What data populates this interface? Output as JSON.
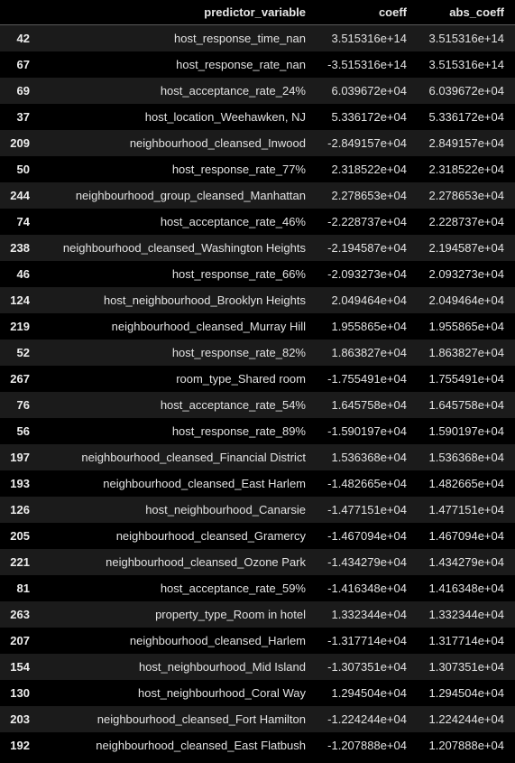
{
  "table": {
    "headers": [
      "",
      "predictor_variable",
      "coeff",
      "abs_coeff"
    ],
    "rows": [
      {
        "index": "42",
        "predictor": "host_response_time_nan",
        "coeff": "3.515316e+14",
        "abs_coeff": "3.515316e+14"
      },
      {
        "index": "67",
        "predictor": "host_response_rate_nan",
        "coeff": "-3.515316e+14",
        "abs_coeff": "3.515316e+14"
      },
      {
        "index": "69",
        "predictor": "host_acceptance_rate_24%",
        "coeff": "6.039672e+04",
        "abs_coeff": "6.039672e+04"
      },
      {
        "index": "37",
        "predictor": "host_location_Weehawken, NJ",
        "coeff": "5.336172e+04",
        "abs_coeff": "5.336172e+04"
      },
      {
        "index": "209",
        "predictor": "neighbourhood_cleansed_Inwood",
        "coeff": "-2.849157e+04",
        "abs_coeff": "2.849157e+04"
      },
      {
        "index": "50",
        "predictor": "host_response_rate_77%",
        "coeff": "2.318522e+04",
        "abs_coeff": "2.318522e+04"
      },
      {
        "index": "244",
        "predictor": "neighbourhood_group_cleansed_Manhattan",
        "coeff": "2.278653e+04",
        "abs_coeff": "2.278653e+04"
      },
      {
        "index": "74",
        "predictor": "host_acceptance_rate_46%",
        "coeff": "-2.228737e+04",
        "abs_coeff": "2.228737e+04"
      },
      {
        "index": "238",
        "predictor": "neighbourhood_cleansed_Washington Heights",
        "coeff": "-2.194587e+04",
        "abs_coeff": "2.194587e+04"
      },
      {
        "index": "46",
        "predictor": "host_response_rate_66%",
        "coeff": "-2.093273e+04",
        "abs_coeff": "2.093273e+04"
      },
      {
        "index": "124",
        "predictor": "host_neighbourhood_Brooklyn Heights",
        "coeff": "2.049464e+04",
        "abs_coeff": "2.049464e+04"
      },
      {
        "index": "219",
        "predictor": "neighbourhood_cleansed_Murray Hill",
        "coeff": "1.955865e+04",
        "abs_coeff": "1.955865e+04"
      },
      {
        "index": "52",
        "predictor": "host_response_rate_82%",
        "coeff": "1.863827e+04",
        "abs_coeff": "1.863827e+04"
      },
      {
        "index": "267",
        "predictor": "room_type_Shared room",
        "coeff": "-1.755491e+04",
        "abs_coeff": "1.755491e+04"
      },
      {
        "index": "76",
        "predictor": "host_acceptance_rate_54%",
        "coeff": "1.645758e+04",
        "abs_coeff": "1.645758e+04"
      },
      {
        "index": "56",
        "predictor": "host_response_rate_89%",
        "coeff": "-1.590197e+04",
        "abs_coeff": "1.590197e+04"
      },
      {
        "index": "197",
        "predictor": "neighbourhood_cleansed_Financial District",
        "coeff": "1.536368e+04",
        "abs_coeff": "1.536368e+04"
      },
      {
        "index": "193",
        "predictor": "neighbourhood_cleansed_East Harlem",
        "coeff": "-1.482665e+04",
        "abs_coeff": "1.482665e+04"
      },
      {
        "index": "126",
        "predictor": "host_neighbourhood_Canarsie",
        "coeff": "-1.477151e+04",
        "abs_coeff": "1.477151e+04"
      },
      {
        "index": "205",
        "predictor": "neighbourhood_cleansed_Gramercy",
        "coeff": "-1.467094e+04",
        "abs_coeff": "1.467094e+04"
      },
      {
        "index": "221",
        "predictor": "neighbourhood_cleansed_Ozone Park",
        "coeff": "-1.434279e+04",
        "abs_coeff": "1.434279e+04"
      },
      {
        "index": "81",
        "predictor": "host_acceptance_rate_59%",
        "coeff": "-1.416348e+04",
        "abs_coeff": "1.416348e+04"
      },
      {
        "index": "263",
        "predictor": "property_type_Room in hotel",
        "coeff": "1.332344e+04",
        "abs_coeff": "1.332344e+04"
      },
      {
        "index": "207",
        "predictor": "neighbourhood_cleansed_Harlem",
        "coeff": "-1.317714e+04",
        "abs_coeff": "1.317714e+04"
      },
      {
        "index": "154",
        "predictor": "host_neighbourhood_Mid Island",
        "coeff": "-1.307351e+04",
        "abs_coeff": "1.307351e+04"
      },
      {
        "index": "130",
        "predictor": "host_neighbourhood_Coral Way",
        "coeff": "1.294504e+04",
        "abs_coeff": "1.294504e+04"
      },
      {
        "index": "203",
        "predictor": "neighbourhood_cleansed_Fort Hamilton",
        "coeff": "-1.224244e+04",
        "abs_coeff": "1.224244e+04"
      },
      {
        "index": "192",
        "predictor": "neighbourhood_cleansed_East Flatbush",
        "coeff": "-1.207888e+04",
        "abs_coeff": "1.207888e+04"
      }
    ]
  }
}
